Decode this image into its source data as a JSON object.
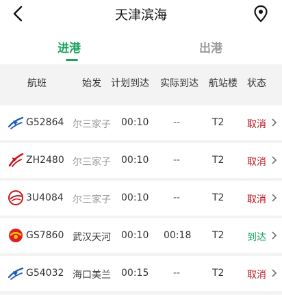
{
  "header": {
    "title": "天津滨海"
  },
  "tabs": {
    "arrivals": "进港",
    "departures": "出港"
  },
  "columns": {
    "flight": "航班",
    "origin": "始发",
    "scheduled": "计划到达",
    "actual": "实际到达",
    "terminal": "航站楼",
    "status": "状态"
  },
  "rows": [
    {
      "flight": "G52864",
      "origin": "尔三家子",
      "scheduled": "00:10",
      "actual": "--",
      "terminal": "T2",
      "status": "取消"
    },
    {
      "flight": "ZH2480",
      "origin": "尔三家子",
      "scheduled": "00:10",
      "actual": "--",
      "terminal": "T2",
      "status": "取消"
    },
    {
      "flight": "3U4084",
      "origin": "尔三家子",
      "scheduled": "00:10",
      "actual": "--",
      "terminal": "T2",
      "status": "取消"
    },
    {
      "flight": "GS7860",
      "origin": "武汉天河",
      "scheduled": "00:10",
      "actual": "00:18",
      "terminal": "T2",
      "status": "到达"
    },
    {
      "flight": "G54032",
      "origin": "海口美兰",
      "scheduled": "00:15",
      "actual": "--",
      "terminal": "T2",
      "status": "取消"
    }
  ],
  "colors": {
    "accent": "#1aa35b",
    "cancel": "#b8141b"
  }
}
